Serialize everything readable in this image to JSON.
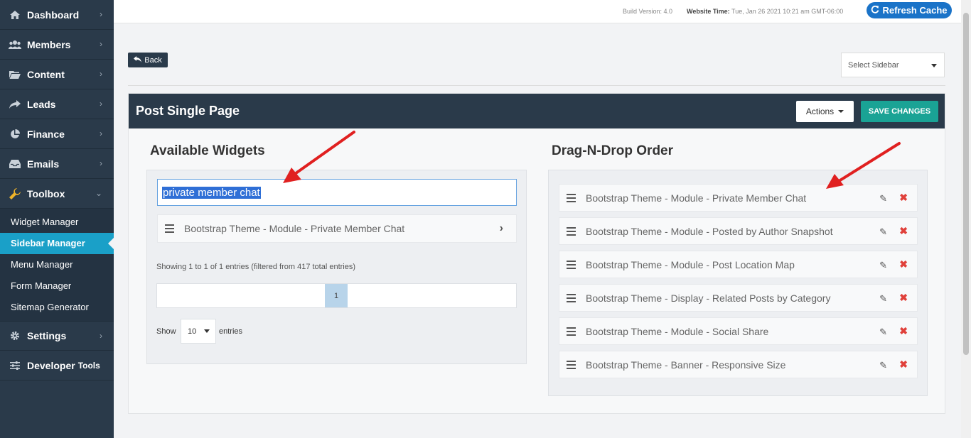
{
  "sidebar": {
    "items": [
      {
        "label": "Dashboard",
        "icon": "home-icon"
      },
      {
        "label": "Members",
        "icon": "users-icon"
      },
      {
        "label": "Content",
        "icon": "folder-icon"
      },
      {
        "label": "Leads",
        "icon": "share-icon"
      },
      {
        "label": "Finance",
        "icon": "pie-chart-icon"
      },
      {
        "label": "Emails",
        "icon": "inbox-icon"
      },
      {
        "label": "Toolbox",
        "icon": "wrench-icon"
      }
    ],
    "toolbox_sub": [
      {
        "label": "Widget Manager"
      },
      {
        "label": "Sidebar Manager"
      },
      {
        "label": "Menu Manager"
      },
      {
        "label": "Form Manager"
      },
      {
        "label": "Sitemap Generator"
      }
    ],
    "settings_label": "Settings",
    "developer_label": "Developer",
    "developer_small": "Tools"
  },
  "topbar": {
    "build_version": "Build Version: 4.0",
    "website_time_label": "Website Time:",
    "website_time_value": "Tue, Jan 26 2021 10:21 am GMT-06:00",
    "refresh_label": "Refresh Cache"
  },
  "back_label": "Back",
  "select_sidebar_label": "Select Sidebar",
  "panel": {
    "title": "Post Single Page",
    "actions_label": "Actions",
    "save_label": "SAVE CHANGES"
  },
  "available": {
    "title": "Available Widgets",
    "search_value": "private member chat",
    "results": [
      "Bootstrap Theme - Module - Private Member Chat"
    ],
    "entries_info": "Showing 1 to 1 of 1 entries (filtered from 417 total entries)",
    "page": "1",
    "show_label": "Show",
    "show_value": "10",
    "entries_label": "entries"
  },
  "order": {
    "title": "Drag-N-Drop Order",
    "items": [
      "Bootstrap Theme - Module - Private Member Chat",
      "Bootstrap Theme - Module - Posted by Author Snapshot",
      "Bootstrap Theme - Module - Post Location Map",
      "Bootstrap Theme - Display - Related Posts by Category",
      "Bootstrap Theme - Module - Social Share",
      "Bootstrap Theme - Banner - Responsive Size"
    ]
  },
  "colors": {
    "sidebar_bg": "#2a3a4a",
    "active_item": "#1aa0c8",
    "save_button": "#1aa395",
    "refresh_button": "#1a73c8",
    "delete_icon": "#e0403a",
    "annotation_arrow": "#e02020"
  }
}
